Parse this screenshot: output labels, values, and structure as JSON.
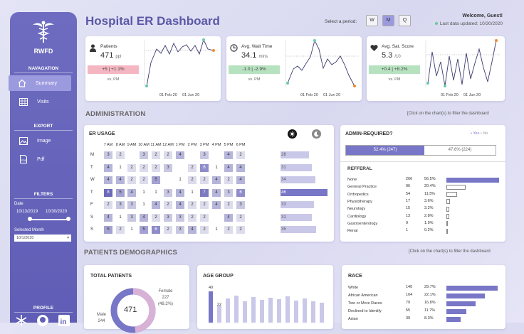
{
  "brand": "RWFD",
  "nav": {
    "heading": "NAVAGATION",
    "items": [
      {
        "label": "Summary",
        "icon": "home-icon"
      },
      {
        "label": "Visits",
        "icon": "table-icon"
      }
    ]
  },
  "export": {
    "heading": "EXPORT",
    "items": [
      {
        "label": "Image",
        "icon": "image-icon"
      },
      {
        "label": "Pdf",
        "icon": "pdf-icon"
      }
    ]
  },
  "filters": {
    "heading": "FILTERS",
    "date_label": "Date",
    "date_from": "10/13/2019",
    "date_to": "10/30/2020",
    "month_label": "Selected Month",
    "month_value": "10/1/2020"
  },
  "profile": {
    "heading": "PROFILE",
    "icons": [
      "snowflake-icon",
      "github-icon",
      "linkedin-icon"
    ]
  },
  "header": {
    "title": "Hospital ER Dashboard",
    "period_label": "Select a period:",
    "periods": [
      "W",
      "M",
      "Q"
    ],
    "active_period": "M",
    "welcome": "Welcome, Guest!",
    "updated": "Last data updated: 10/30/2020"
  },
  "kpis": [
    {
      "name": "Patients",
      "value": "471",
      "unit": "ppl",
      "change": "+5 | +1.1%",
      "tone": "neg",
      "pm": "vs. PM",
      "d1": "01 Feb 20",
      "d2": "01 Jun 20",
      "icon": "person-icon"
    },
    {
      "name": "Avg. Wait Time",
      "value": "34.1",
      "unit": "mins",
      "change": "-1.0 | -2.9%",
      "tone": "pos",
      "pm": "vs. PM",
      "d1": "01 Feb 20",
      "d2": "01 Jun 20",
      "icon": "clock-icon"
    },
    {
      "name": "Avg. Sat. Score",
      "value": "5.3",
      "unit": "/10",
      "change": "+0.4 | +8.2%",
      "tone": "pos",
      "pm": "vs. PM",
      "d1": "01 Feb 20",
      "d2": "01 Jun 20",
      "icon": "heart-icon"
    }
  ],
  "admin": {
    "section": "ADMINISTRATION",
    "hint": "Click on the chart(s) to filter the dashboard"
  },
  "er": {
    "title": "ER USAGE",
    "hours": [
      "7 AM",
      "8 AM",
      "9 AM",
      "10 AM",
      "11 AM",
      "12 AM",
      "1 PM",
      "2 PM",
      "3 PM",
      "4 PM",
      "5 PM",
      "6 PM"
    ],
    "rows": [
      {
        "day": "M",
        "cells": [
          "3",
          "2",
          "",
          "3",
          "2",
          "2",
          "4",
          "",
          "3",
          "",
          "4",
          "2",
          "3"
        ],
        "total": "28"
      },
      {
        "day": "T",
        "cells": [
          "4",
          "1",
          "2",
          "2",
          "2",
          "3",
          "",
          "2",
          "6",
          "1",
          "4",
          "4"
        ],
        "total": "31"
      },
      {
        "day": "W",
        "cells": [
          "4",
          "4",
          "2",
          "2",
          "5",
          "",
          "1",
          "2",
          "2",
          "4",
          "2",
          "4"
        ],
        "total": "34"
      },
      {
        "day": "T",
        "cells": [
          "8",
          "5",
          "4",
          "1",
          "1",
          "3",
          "4",
          "1",
          "7",
          "4",
          "3",
          "6"
        ],
        "total": "46"
      },
      {
        "day": "F",
        "cells": [
          "2",
          "3",
          "3",
          "1",
          "4",
          "2",
          "4",
          "2",
          "2",
          "4",
          "2",
          "3"
        ],
        "total": "33"
      },
      {
        "day": "S",
        "cells": [
          "4",
          "1",
          "3",
          "4",
          "2",
          "3",
          "3",
          "2",
          "2",
          "",
          "4",
          "2"
        ],
        "total": "31"
      },
      {
        "day": "S",
        "cells": [
          "5",
          "2",
          "1",
          "5",
          "6",
          "2",
          "3",
          "4",
          "2",
          "1",
          "2",
          "2"
        ],
        "total": "35"
      }
    ]
  },
  "admin_required": {
    "title": "ADMIN-REQUIRED?",
    "legend_yes": "• Yes",
    "legend_no": "• No",
    "yes": "52.4% (247)",
    "no": "47.6% (224)",
    "yes_share": 0.524
  },
  "referral": {
    "title": "REFFERAL",
    "rows": [
      {
        "name": "None",
        "count": "266",
        "pct": "56.5%",
        "share": 0.565,
        "light": true
      },
      {
        "name": "General Practice",
        "count": "96",
        "pct": "20.4%",
        "share": 0.204,
        "light": true
      },
      {
        "name": "Orthopedics",
        "count": "54",
        "pct": "11.5%",
        "share": 0.115,
        "light": true
      },
      {
        "name": "Physiotherapy",
        "count": "17",
        "pct": "3.6%",
        "share": 0.036,
        "light": true
      },
      {
        "name": "Neurology",
        "count": "15",
        "pct": "3.2%",
        "share": 0.032,
        "light": true
      },
      {
        "name": "Cardiology",
        "count": "13",
        "pct": "2.8%",
        "share": 0.028,
        "light": true
      },
      {
        "name": "Gastroenterology",
        "count": "9",
        "pct": "1.9%",
        "share": 0.019,
        "light": true
      },
      {
        "name": "Renal",
        "count": "1",
        "pct": "0.2%",
        "share": 0.002,
        "light": true
      }
    ]
  },
  "demo": {
    "section": "PATIENTS DEMOGRAPHICS",
    "hint": "Click on the chart(s) to filter the dashboard"
  },
  "total_patients": {
    "title": "TOTAL PATIENTS",
    "value": "471",
    "female_label": "Female",
    "female_count": "227",
    "female_pct": "(48.2%)",
    "male_label": "Male",
    "male_count": "244",
    "female_share": 0.482
  },
  "age": {
    "title": "AGE GROUP",
    "label_a": "40",
    "label_b": "22"
  },
  "race": {
    "title": "RACE",
    "rows": [
      {
        "name": "White",
        "count": "140",
        "pct": "29.7%",
        "share": 0.297
      },
      {
        "name": "African American",
        "count": "104",
        "pct": "22.1%",
        "share": 0.221
      },
      {
        "name": "Two or More Races",
        "count": "79",
        "pct": "16.8%",
        "share": 0.168
      },
      {
        "name": "Declined to Identify",
        "count": "55",
        "pct": "11.7%",
        "share": 0.117
      },
      {
        "name": "Asian",
        "count": "39",
        "pct": "8.3%",
        "share": 0.083
      }
    ]
  },
  "colors": {
    "accent": "#7876c6",
    "sidebar": "#6260b6",
    "pos": "#b7e2c0",
    "neg": "#f4b7c2"
  }
}
